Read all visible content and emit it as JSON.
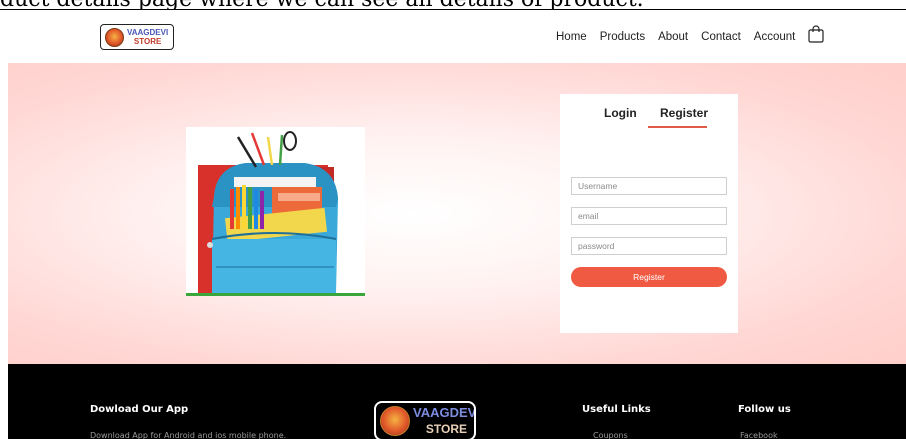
{
  "caption": "duct details page where we can see all details of product.",
  "brand": {
    "line1": "VAAGDEVI",
    "line2": "STORE"
  },
  "nav": {
    "items": [
      "Home",
      "Products",
      "About",
      "Contact",
      "Account"
    ],
    "cart_icon": "shopping-bag-icon"
  },
  "hero": {
    "image": "school-backpack-with-stationery"
  },
  "auth": {
    "tabs": [
      "Login",
      "Register"
    ],
    "active_tab": "Register",
    "username_placeholder": "Username",
    "email_placeholder": "email",
    "password_placeholder": "password",
    "submit_label": "Register"
  },
  "footer": {
    "app_title": "Dowload Our App",
    "app_text": "Download App for Android and ios mobile phone.",
    "links_title": "Useful Links",
    "links_first": "Coupons",
    "follow_title": "Follow us",
    "follow_first": "Facebook"
  },
  "colors": {
    "accent": "#f15a42",
    "hero_bg": "#ffd7d4",
    "footer_bg": "#000000"
  }
}
